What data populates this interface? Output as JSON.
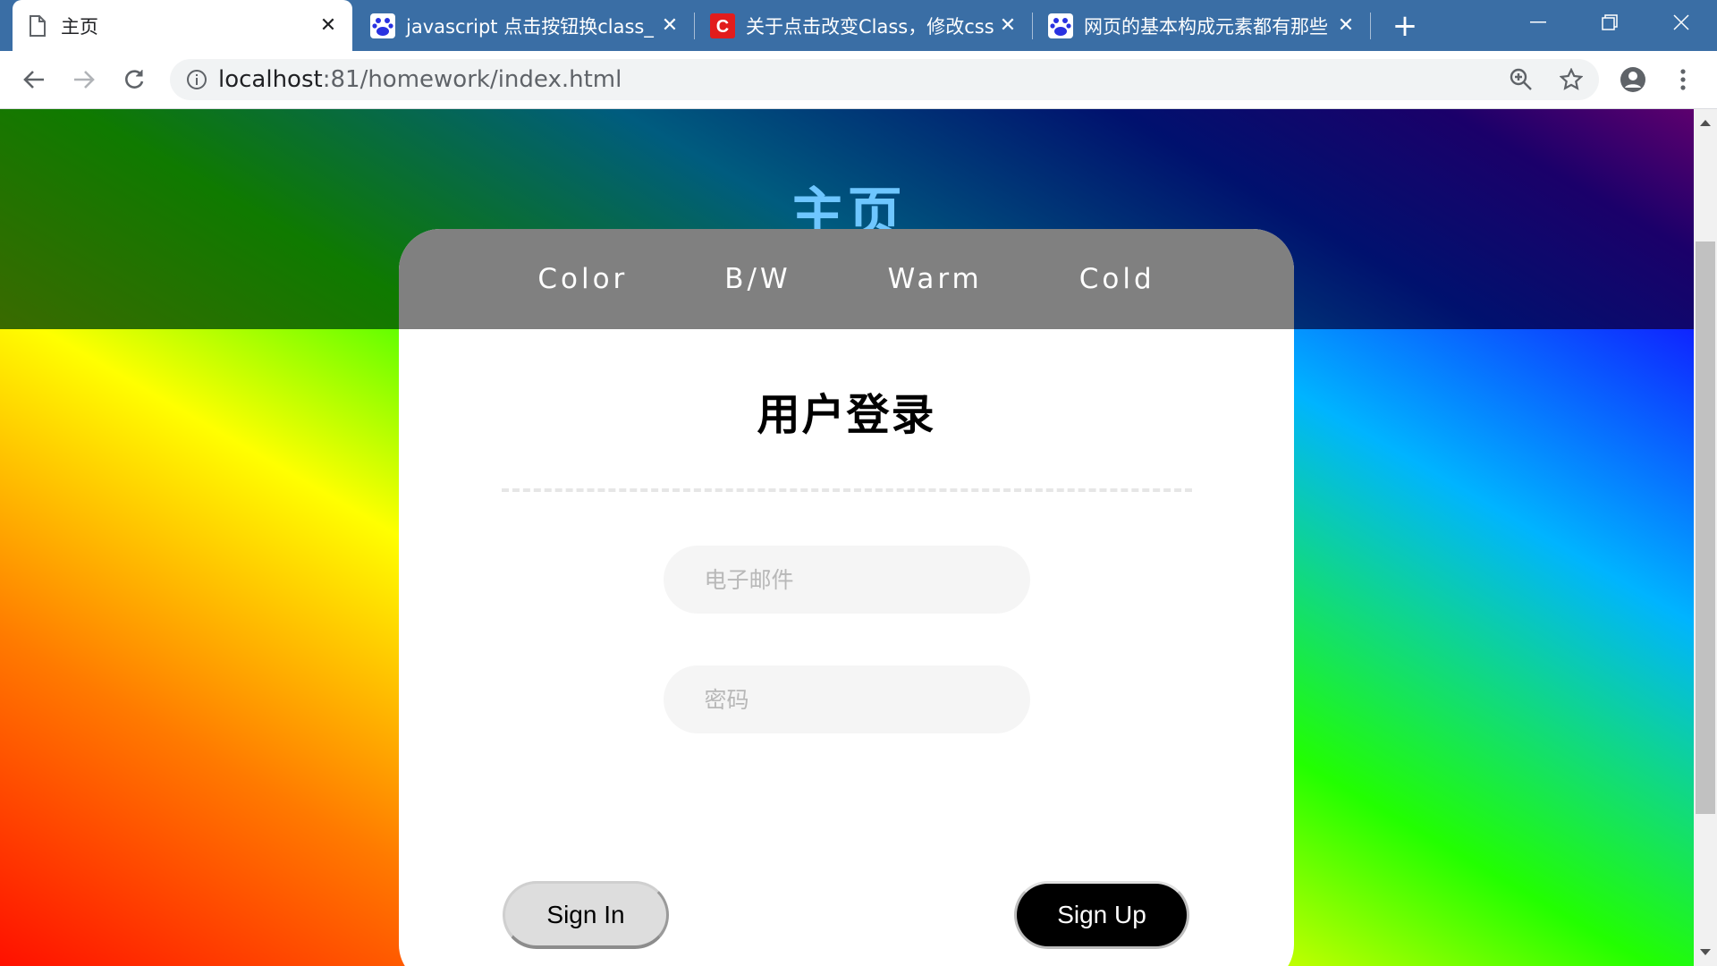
{
  "browser": {
    "tabs": [
      {
        "title": "主页",
        "active": true,
        "favicon": "page-icon"
      },
      {
        "title": "javascript 点击按钮换class_",
        "active": false,
        "favicon": "baidu-paw-icon"
      },
      {
        "title": "关于点击改变Class，修改css",
        "active": false,
        "favicon": "csdn-c-icon"
      },
      {
        "title": "网页的基本构成元素都有那些",
        "active": false,
        "favicon": "baidu-paw-icon"
      }
    ],
    "new_tab_label": "+",
    "address": {
      "host": "localhost",
      "path": ":81/homework/index.html"
    },
    "colors": {
      "titlebar": "#3a6ea5",
      "omnibox": "#f1f3f4"
    }
  },
  "page": {
    "title": "主页",
    "themes": [
      "Color",
      "B/W",
      "Warm",
      "Cold"
    ],
    "login": {
      "heading": "用户登录",
      "email_placeholder": "电子邮件",
      "email_value": "",
      "password_placeholder": "密码",
      "password_value": "",
      "signin_label": "Sign In",
      "signup_label": "Sign Up"
    },
    "colors": {
      "title": "#6ec6ff",
      "theme_bar": "#808080",
      "card": "#ffffff",
      "signup_bg": "#000000",
      "signin_bg": "#dddddd"
    }
  }
}
